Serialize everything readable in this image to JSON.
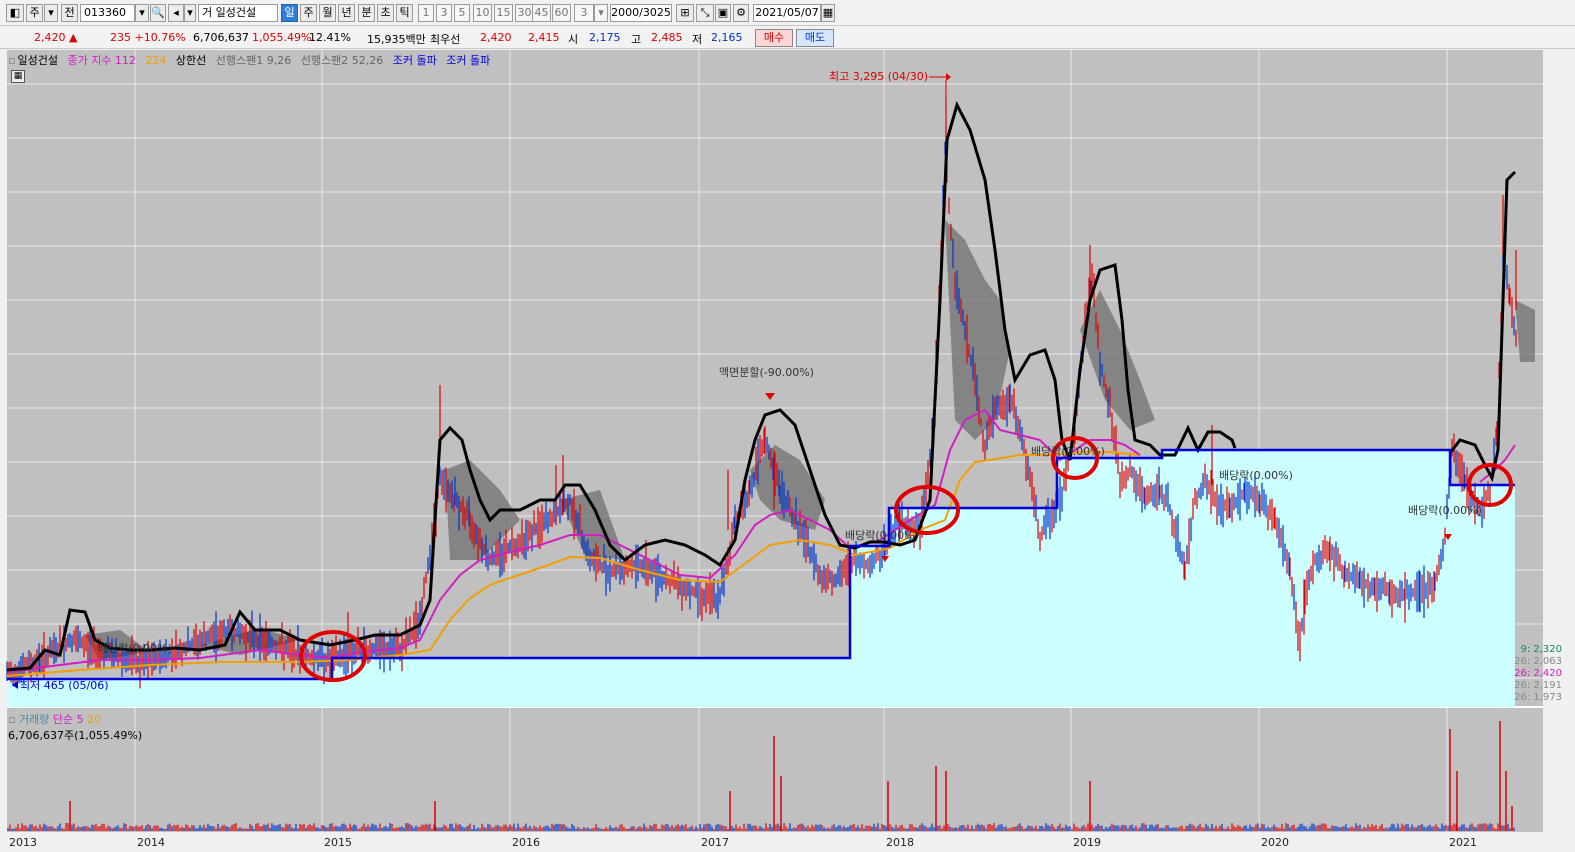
{
  "toolbar": {
    "unit_label": "주",
    "all_label": "전",
    "code": "013360",
    "stock_prefix": "거",
    "stock_name": "일성건설",
    "periods": [
      "일",
      "주",
      "월",
      "년",
      "분",
      "초",
      "틱"
    ],
    "active_period": "일",
    "intervals": [
      "1",
      "3",
      "5",
      "10",
      "15",
      "30",
      "45",
      "60"
    ],
    "count_value": "3",
    "bars": "2000/3025",
    "date": "2021/05/07"
  },
  "quote": {
    "price": "2,420",
    "change": "235",
    "change_pct": "+10.76%",
    "volume": "6,706,637",
    "volume_pct": "1,055.49%",
    "turnover_pct": "12.41%",
    "amount": "15,935백만",
    "best_label": "최우선",
    "ask": "2,420",
    "bid": "2,415",
    "open_label": "시",
    "open": "2,175",
    "high_label": "고",
    "high": "2,485",
    "low_label": "저",
    "low": "2,165",
    "buy_label": "매수",
    "sell_label": "매도"
  },
  "legend": {
    "stock": "일성건설",
    "ma": "종가 지수 112",
    "ma2": "224",
    "limit": "상한선",
    "span1": "선행스팬1 9,26",
    "span2": "선행스팬2 52,26",
    "breakout1": "조커 돌파",
    "breakout2": "조커 돌파"
  },
  "volume_legend": {
    "label": "거래량",
    "simple": "단순 5",
    "ma20": "20",
    "value": "6,706,637주(1,055.49%)"
  },
  "annotations": {
    "high": "최고 3,295 (04/30)",
    "low": "최저 465 (05/06)",
    "split": "액면분할(-90.00%)",
    "dividend1": "배당락(0.00%)",
    "dividend2": "배당락(0.00%)",
    "dividend3": "배당락(0.00%)",
    "dividend4": "배당락(0.00%)",
    "dividend5": "배당락(0.00%)"
  },
  "right_values": [
    "9: 2,320",
    "26: 2,063",
    "26: 2,420",
    "26: 2,191",
    "26: 1,973"
  ],
  "x_axis": [
    "2013",
    "2014",
    "2015",
    "2016",
    "2017",
    "2018",
    "2019",
    "2020",
    "2021"
  ],
  "colors": {
    "up": "#e00000",
    "down": "#0033cc",
    "ma112": "#d020c0",
    "ma224": "#f0a000",
    "limit": "#000000",
    "breakout": "#0000dd",
    "band": "#ccffff",
    "cloud": "#707070",
    "circle": "#e00000"
  },
  "chart_data": {
    "type": "line",
    "title": "일성건설",
    "x": [
      "2013",
      "2014",
      "2015",
      "2016",
      "2017",
      "2018",
      "2019",
      "2020",
      "2021"
    ],
    "series": [
      {
        "name": "조커 돌파",
        "values": [
          465,
          470,
          600,
          600,
          1000,
          1150,
          1750,
          1900,
          1800
        ]
      }
    ],
    "annotations": [
      "최고 3,295 (04/30)",
      "최저 465 (05/06)"
    ]
  }
}
